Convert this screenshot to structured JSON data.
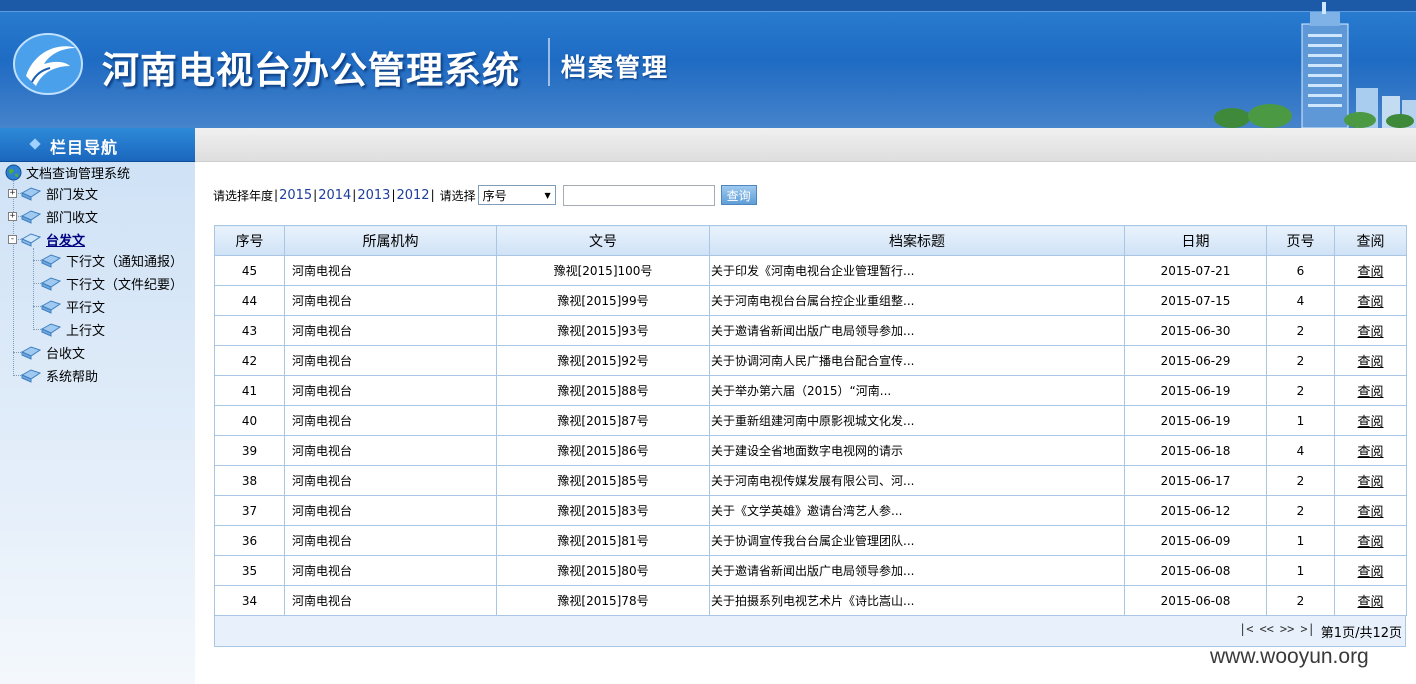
{
  "header": {
    "top_text": "",
    "system_title": "河南电视台办公管理系统",
    "module_title": "档案管理"
  },
  "nav": {
    "heading": "栏目导航",
    "root": "文档查询管理系统",
    "items": [
      {
        "label": "部门发文"
      },
      {
        "label": "部门收文"
      },
      {
        "label": "台发文"
      },
      {
        "label": "下行文（通知通报）"
      },
      {
        "label": "下行文（文件纪要）"
      },
      {
        "label": "平行文"
      },
      {
        "label": "上行文"
      },
      {
        "label": "台收文"
      },
      {
        "label": "系统帮助"
      }
    ]
  },
  "filter": {
    "year_prompt": "请选择年度",
    "years": [
      "2015",
      "2014",
      "2013",
      "2012"
    ],
    "select_prompt": "请选择",
    "select_value": "序号",
    "search_value": "",
    "search_button": "查询"
  },
  "table": {
    "headers": [
      "序号",
      "所属机构",
      "文号",
      "档案标题",
      "日期",
      "页号",
      "查阅"
    ],
    "rows": [
      [
        "45",
        "河南电视台",
        "豫视[2015]100号",
        "关于印发《河南电视台企业管理暂行...",
        "2015-07-21",
        "6",
        "查阅"
      ],
      [
        "44",
        "河南电视台",
        "豫视[2015]99号",
        "关于河南电视台台属台控企业重组整...",
        "2015-07-15",
        "4",
        "查阅"
      ],
      [
        "43",
        "河南电视台",
        "豫视[2015]93号",
        "关于邀请省新闻出版广电局领导参加...",
        "2015-06-30",
        "2",
        "查阅"
      ],
      [
        "42",
        "河南电视台",
        "豫视[2015]92号",
        "关于协调河南人民广播电台配合宣传...",
        "2015-06-29",
        "2",
        "查阅"
      ],
      [
        "41",
        "河南电视台",
        "豫视[2015]88号",
        "关于举办第六届（2015）“河南...",
        "2015-06-19",
        "2",
        "查阅"
      ],
      [
        "40",
        "河南电视台",
        "豫视[2015]87号",
        "关于重新组建河南中原影视城文化发...",
        "2015-06-19",
        "1",
        "查阅"
      ],
      [
        "39",
        "河南电视台",
        "豫视[2015]86号",
        "关于建设全省地面数字电视网的请示",
        "2015-06-18",
        "4",
        "查阅"
      ],
      [
        "38",
        "河南电视台",
        "豫视[2015]85号",
        "关于河南电视传媒发展有限公司、河...",
        "2015-06-17",
        "2",
        "查阅"
      ],
      [
        "37",
        "河南电视台",
        "豫视[2015]83号",
        "关于《文学英雄》邀请台湾艺人参...",
        "2015-06-12",
        "2",
        "查阅"
      ],
      [
        "36",
        "河南电视台",
        "豫视[2015]81号",
        "关于协调宣传我台台属企业管理团队...",
        "2015-06-09",
        "1",
        "查阅"
      ],
      [
        "35",
        "河南电视台",
        "豫视[2015]80号",
        "关于邀请省新闻出版广电局领导参加...",
        "2015-06-08",
        "1",
        "查阅"
      ],
      [
        "34",
        "河南电视台",
        "豫视[2015]78号",
        "关于拍摄系列电视艺术片《诗比嵩山...",
        "2015-06-08",
        "2",
        "查阅"
      ]
    ]
  },
  "pager": {
    "first": "|<",
    "prev": "<<",
    "next": ">>",
    "last": ">|",
    "status": "第1页/共12页"
  },
  "watermark": "www.wooyun.org",
  "colors": {
    "header_blue": "#1f6cc4",
    "nav_blue": "#1a67bd",
    "table_border": "#a9c6e4",
    "link_blue": "#1f3f9c"
  }
}
